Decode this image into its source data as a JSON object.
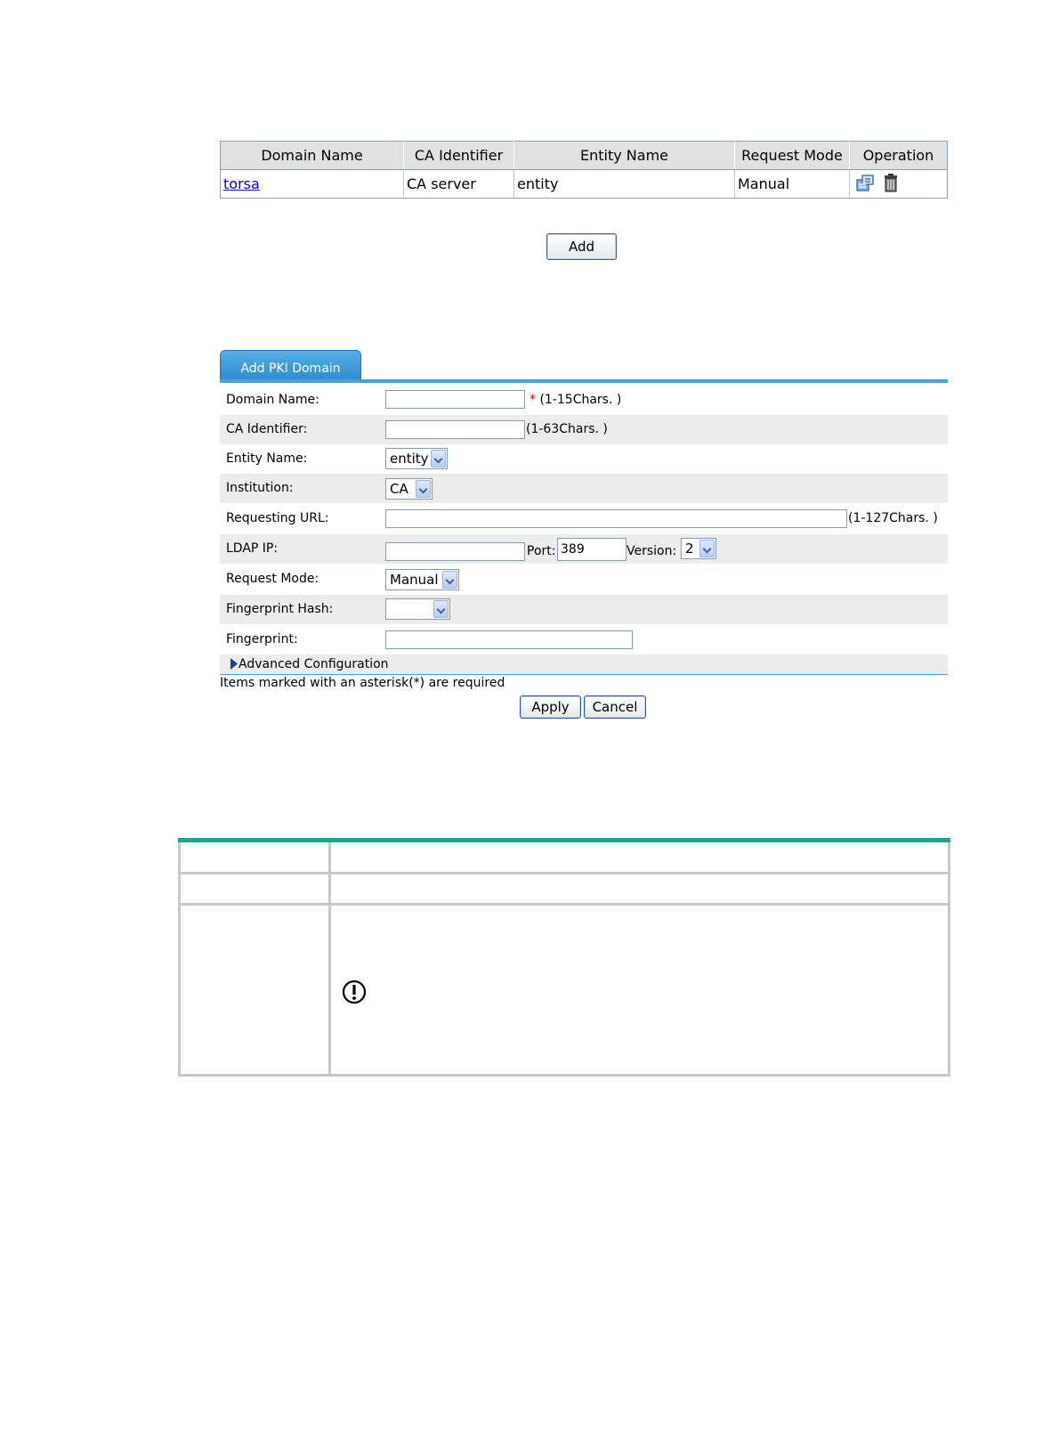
{
  "domain_table": {
    "headers": [
      "Domain Name",
      "CA Identifier",
      "Entity Name",
      "Request Mode",
      "Operation"
    ],
    "rows": [
      {
        "domain_name": "torsa",
        "ca_identifier": "CA server",
        "entity_name": "entity",
        "request_mode": "Manual"
      }
    ],
    "operation_icons": [
      "details-icon",
      "delete-icon"
    ]
  },
  "add_button": "Add",
  "form": {
    "tab_label": "Add PKI Domain",
    "domain_name_label": "Domain Name:",
    "domain_name_value": "",
    "required_mark": "*",
    "domain_name_hint": "(1-15Chars. )",
    "ca_identifier_label": "CA Identifier:",
    "ca_identifier_value": "",
    "ca_identifier_hint": "(1-63Chars. )",
    "entity_name_label": "Entity Name:",
    "entity_name_value": "entity",
    "institution_label": "Institution:",
    "institution_value": "CA",
    "requesting_url_label": "Requesting URL:",
    "requesting_url_value": "",
    "requesting_url_hint": "(1-127Chars. )",
    "ldap_ip_label": "LDAP IP:",
    "ldap_ip_value": "",
    "port_label": "Port:",
    "port_value": "389",
    "version_label": "Version:",
    "version_value": "2",
    "request_mode_label": "Request Mode:",
    "request_mode_value": "Manual",
    "fingerprint_hash_label": "Fingerprint Hash:",
    "fingerprint_hash_value": "",
    "fingerprint_label": "Fingerprint:",
    "fingerprint_value": "",
    "advanced_label": "Advanced Configuration",
    "required_note": "Items marked with an asterisk(*) are required",
    "apply_label": "Apply",
    "cancel_label": "Cancel"
  },
  "colors": {
    "tab_blue": "#2d8ad0",
    "doc_table_bar": "#1aa68a",
    "link": "#0000ee",
    "required": "#e30000"
  },
  "doc_table": {
    "note_icon": "important-icon"
  }
}
